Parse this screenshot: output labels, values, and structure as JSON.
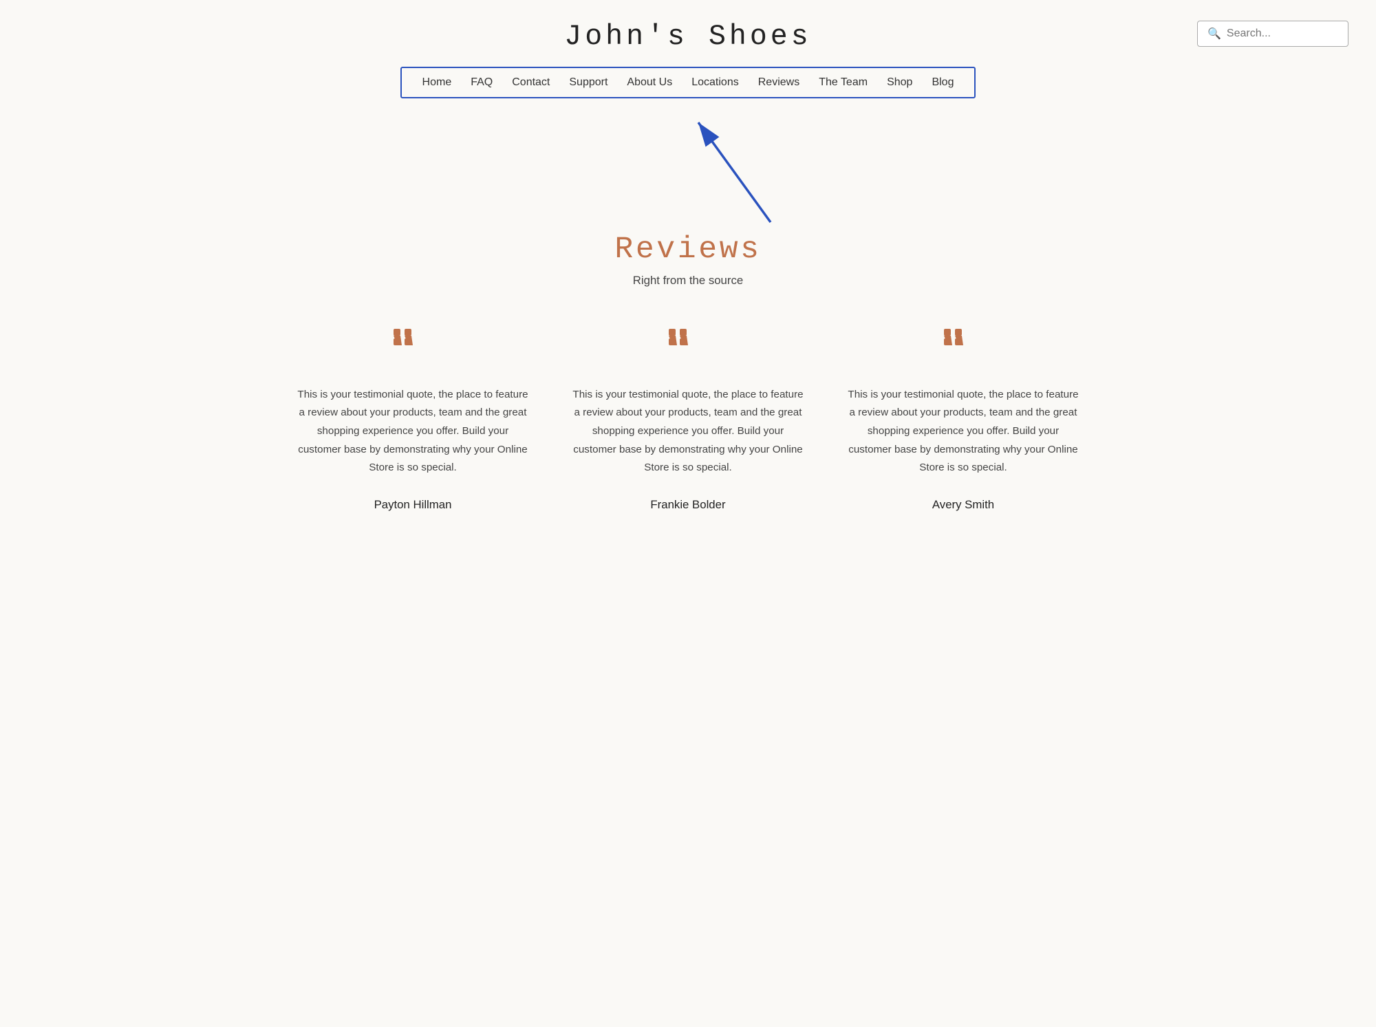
{
  "header": {
    "site_title": "John's  Shoes",
    "search_placeholder": "Search..."
  },
  "nav": {
    "items": [
      {
        "label": "Home",
        "id": "home"
      },
      {
        "label": "FAQ",
        "id": "faq"
      },
      {
        "label": "Contact",
        "id": "contact"
      },
      {
        "label": "Support",
        "id": "support"
      },
      {
        "label": "About Us",
        "id": "about"
      },
      {
        "label": "Locations",
        "id": "locations"
      },
      {
        "label": "Reviews",
        "id": "reviews"
      },
      {
        "label": "The Team",
        "id": "team"
      },
      {
        "label": "Shop",
        "id": "shop"
      },
      {
        "label": "Blog",
        "id": "blog"
      }
    ]
  },
  "reviews_section": {
    "title": "Reviews",
    "subtitle": "Right from the source",
    "testimonials": [
      {
        "quote": "This is your testimonial quote, the place to feature a review about your products, team and the great shopping experience you offer. Build your customer base by demonstrating why your Online Store is so special.",
        "reviewer": "Payton Hillman"
      },
      {
        "quote": "This is your testimonial quote, the place to feature a review about your products, team and the great shopping experience you offer. Build your customer base by demonstrating why your Online Store is so special.",
        "reviewer": "Frankie Bolder"
      },
      {
        "quote": "This is your testimonial quote, the place to feature a review about your products, team and the great shopping experience you offer. Build your customer base by demonstrating why your Online Store is so special.",
        "reviewer": "Avery Smith"
      }
    ]
  },
  "colors": {
    "accent": "#c0724a",
    "nav_border": "#2a52be",
    "arrow": "#2a52be"
  }
}
